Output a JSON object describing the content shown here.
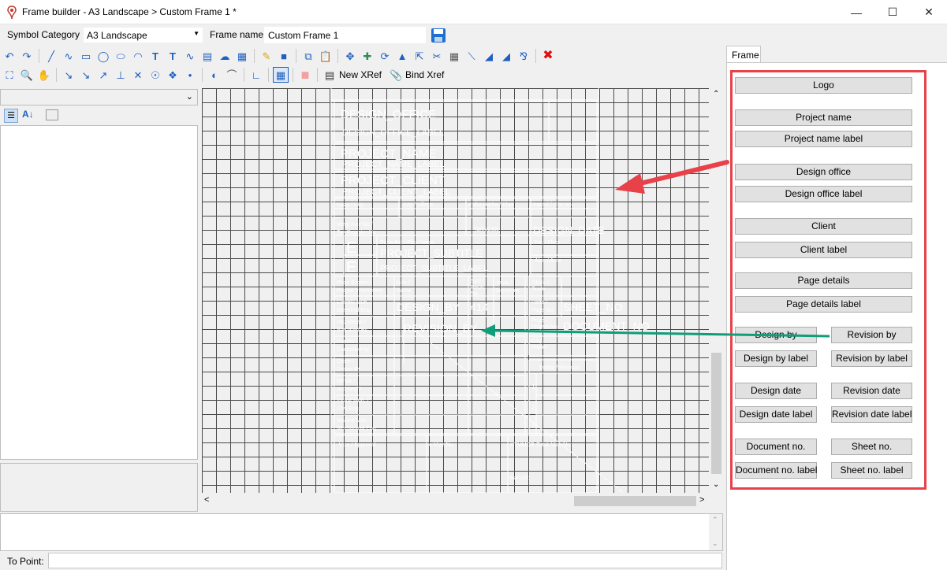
{
  "window": {
    "title": "Frame builder - A3 Landscape > Custom Frame 1 *",
    "minimize_icon": "minimize-icon",
    "maximize_icon": "maximize-icon",
    "close_icon": "close-icon"
  },
  "top_row": {
    "symbol_category_label": "Symbol Category",
    "symbol_category_value": "A3 Landscape",
    "frame_name_label": "Frame name",
    "frame_name_value": "Custom Frame 1"
  },
  "toolbar2": {
    "new_xref_label": "New XRef",
    "bind_xref_label": "Bind Xref"
  },
  "frame_tab": {
    "label": "Frame",
    "buttons": {
      "logo": "Logo",
      "project_name": "Project name",
      "project_name_label": "Project name label",
      "design_office": "Design office",
      "design_office_label": "Design office label",
      "client": "Client",
      "client_label": "Client label",
      "page_details": "Page details",
      "page_details_label": "Page details label",
      "design_by": "Design by",
      "revision_by": "Revision by",
      "design_by_label": "Design by label",
      "revision_by_label": "Revision by label",
      "design_date": "Design date",
      "revision_date": "Revision date",
      "design_date_label": "Design date label",
      "revision_date_label": "Revision date label",
      "document_no": "Document no.",
      "sheet_no": "Sheet no.",
      "document_no_label": "Document no. label",
      "sheet_no_label": "Sheet no. label"
    }
  },
  "drawing": {
    "design_office": "DESIGN_OFFICE",
    "design_office_label": "DESIGN_OFFICE_LABEL",
    "project_name": "PROJECT_NAME",
    "project_name_label": "PROJECT_NAME_LABEL",
    "project_client": "PROJECT_CLIENT",
    "project_client_label": "PROJECT_CLIENT_LABEL",
    "kaza": "Kaza / City",
    "koy": "Köy / Village",
    "pafta_harita": "Pafta-Harita / Plan",
    "parsel": "Parsel / Plot No.",
    "vergi_1": "Vergi Sicil No /",
    "vergi_2": "Tax Register No",
    "tarih": "Tarih/Date",
    "design_date": "DESIGN_DATE",
    "pafta_adi": "Pafta Adı / Plan Name",
    "project_subtitle": "PROJECT_SUBTITLE",
    "project_subtitle_label": "PROJECT_SUBTITLE_LABEL",
    "logo_e1": "E",
    "logo_e2": "E",
    "kat": "Kat / Floor",
    "alan": "Alan / Area",
    "proje_bilgileri_1": "Proje Bilgileri /",
    "proje_bilgileri_2": "Project Information",
    "isim_1": "İsim /",
    "isim_2": "Name",
    "sicil_1": "Sicil /",
    "sicil_2": "Regis.",
    "sicil_3": "No",
    "imza_1": "İmza /",
    "imza_2": "Signature",
    "olcek_1": "Ölçek /",
    "olcek_2": "Scale",
    "elektrik_1": "Elektrik Müh. /",
    "elektrik_2": "Electrical Eng.",
    "design_by": "DESIGN_BY",
    "sicil_value": "414",
    "pafta_no_1": "Pafta /",
    "pafta_no_2": "Page No.",
    "sheet_no": "SHEET_NO",
    "hazirlayan_1": "Hazırlayan /",
    "hazirlayan_2": "Prepared By",
    "revision_by": "REVISION_BY",
    "proje_no_1": "Proje /",
    "proje_no_2": "Project No",
    "document_no": "DOCUMENT_NO",
    "kontrol_1": "Kontrol /",
    "kontrol_2": "Controlled by",
    "guc_1": "Güç /",
    "guc_2": "Power",
    "cizen_1": "Çizen /",
    "cizen_2": "Drawn By",
    "tadilat": "Tadilat / Revision",
    "mimar_1": "Mimar /",
    "mimar_2": "Architecht",
    "insaat_1": "İnşaat Müh. /",
    "insaat_2": "Civil Eng.",
    "makine_1": "Makine Müh. /",
    "makine_2": "Mechanical Eng.",
    "rev1": "1.",
    "rev2": "2.",
    "rev3": "3.",
    "vize": "Vize / Approval",
    "evize": "e-Vize No :",
    "ktmmob": "KTMMOB Ortak Vize No:",
    "barkod": "Barkod:"
  },
  "status_bar": {
    "to_point_label": "To Point:"
  },
  "colors": {
    "canvas_bg": "#303030",
    "highlight_red": "#e8414a",
    "arrow_green": "#0f9d7a"
  }
}
